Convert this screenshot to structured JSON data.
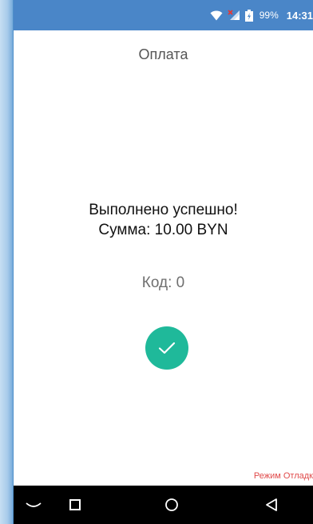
{
  "status_bar": {
    "battery_percent": "99%",
    "time": "14:31",
    "icons": [
      "wifi-icon",
      "signal-icon",
      "battery-charging-icon"
    ]
  },
  "header": {
    "title": "Оплата"
  },
  "result": {
    "line1": "Выполнено успешно!",
    "line2": "Сумма: 10.00 BYN",
    "code": "Код: 0",
    "icon": "checkmark-icon",
    "icon_color": "#1fb99a"
  },
  "footer": {
    "debug_label": "Режим Отладк"
  },
  "nav_bar": {
    "buttons": [
      "keyboard-hide-icon",
      "recents-icon",
      "home-icon",
      "back-icon"
    ]
  },
  "colors": {
    "status_bar": "#4a86c8",
    "debug_text": "#e04a4a"
  }
}
